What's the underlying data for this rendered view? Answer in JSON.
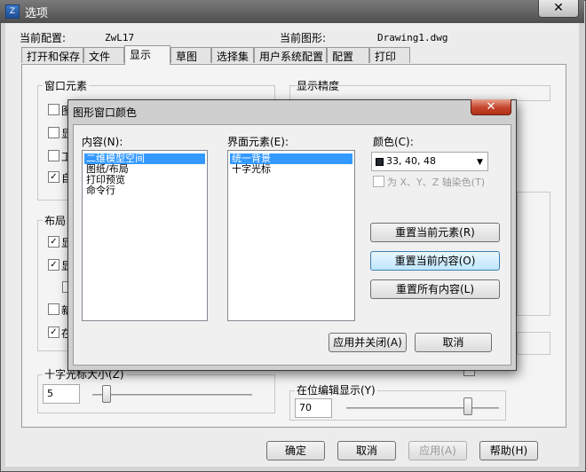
{
  "window": {
    "title": "选项",
    "close_glyph": "✕"
  },
  "profile": {
    "current_config_label": "当前配置:",
    "current_config_value": "ZwL17",
    "current_drawing_label": "当前图形:",
    "current_drawing_value": "Drawing1.dwg"
  },
  "tabs": [
    "打开和保存",
    "文件",
    "显示",
    "草图",
    "选择集",
    "用户系统配置",
    "配置",
    "打印"
  ],
  "display": {
    "window_elements_title": "窗口元素",
    "precision_title": "显示精度",
    "layout_title": "布局",
    "check_partial": [
      "图",
      "显",
      "工",
      "自"
    ],
    "check_layout_partial": [
      "显",
      "显",
      "",
      "新",
      "在"
    ],
    "crosshair_label": "十字光标大小(Z)",
    "crosshair_value": "5",
    "inplace_label": "在位编辑显示(Y)",
    "inplace_value": "70"
  },
  "dialog": {
    "title": "图形窗口颜色",
    "close_glyph": "✕",
    "context_label": "内容(N):",
    "contexts": [
      "二维模型空间",
      "图纸/布局",
      "打印预览",
      "命令行"
    ],
    "elements_label": "界面元素(E):",
    "elements": [
      "统一背景",
      "十字光标"
    ],
    "color_label": "颜色(C):",
    "color_value": "33, 40, 48",
    "tint_label": "为 X、Y、Z 轴染色(T)",
    "reset_element": "重置当前元素(R)",
    "reset_context": "重置当前内容(O)",
    "reset_all": "重置所有内容(L)",
    "apply_close": "应用并关闭(A)",
    "cancel": "取消"
  },
  "footer": {
    "ok": "确定",
    "cancel": "取消",
    "apply": "应用(A)",
    "help": "帮助(H)"
  },
  "colors": {
    "swatch": "#212830",
    "selection": "#3399ff",
    "dialog_close": "#c4442c"
  },
  "icons": {
    "app": "app-icon",
    "dropdown": "chevron-down-icon"
  }
}
